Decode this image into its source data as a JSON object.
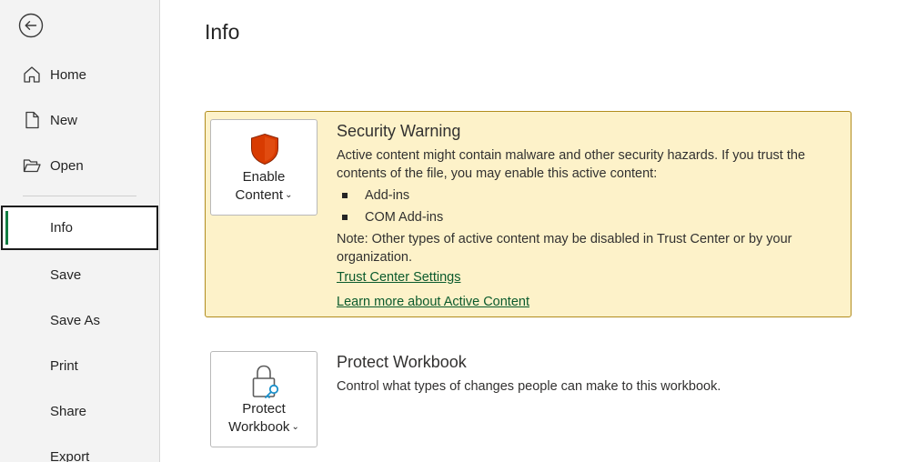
{
  "sidebar": {
    "back_icon": "back-arrow-circle-icon",
    "items": [
      {
        "label": "Home",
        "icon": "home-icon"
      },
      {
        "label": "New",
        "icon": "new-document-icon"
      },
      {
        "label": "Open",
        "icon": "open-folder-icon"
      },
      {
        "label": "Info",
        "selected": true
      },
      {
        "label": "Save"
      },
      {
        "label": "Save As"
      },
      {
        "label": "Print"
      },
      {
        "label": "Share"
      },
      {
        "label": "Export"
      }
    ]
  },
  "main": {
    "title": "Info",
    "security_warning": {
      "button_line1": "Enable",
      "button_line2": "Content",
      "heading": "Security Warning",
      "description_line1": "Active content might contain malware and other security hazards. If you trust the",
      "description_line2": "contents of the file, you may enable this active content:",
      "bullets": [
        "Add-ins",
        "COM Add-ins"
      ],
      "note_line1": "Note: Other types of active content may be disabled in Trust Center or by your",
      "note_line2": "organization.",
      "link_trust_center": "Trust Center Settings",
      "link_learn_more": "Learn more about Active Content",
      "colors": {
        "panel_bg": "#fdf2c9",
        "panel_border": "#b18c1e",
        "shield": "#d83b01",
        "link": "#0b5a2c"
      }
    },
    "protect_workbook": {
      "button_line1": "Protect",
      "button_line2": "Workbook",
      "heading": "Protect Workbook",
      "description": "Control what types of changes people can make to this workbook."
    }
  },
  "accent_color": "#107c41"
}
